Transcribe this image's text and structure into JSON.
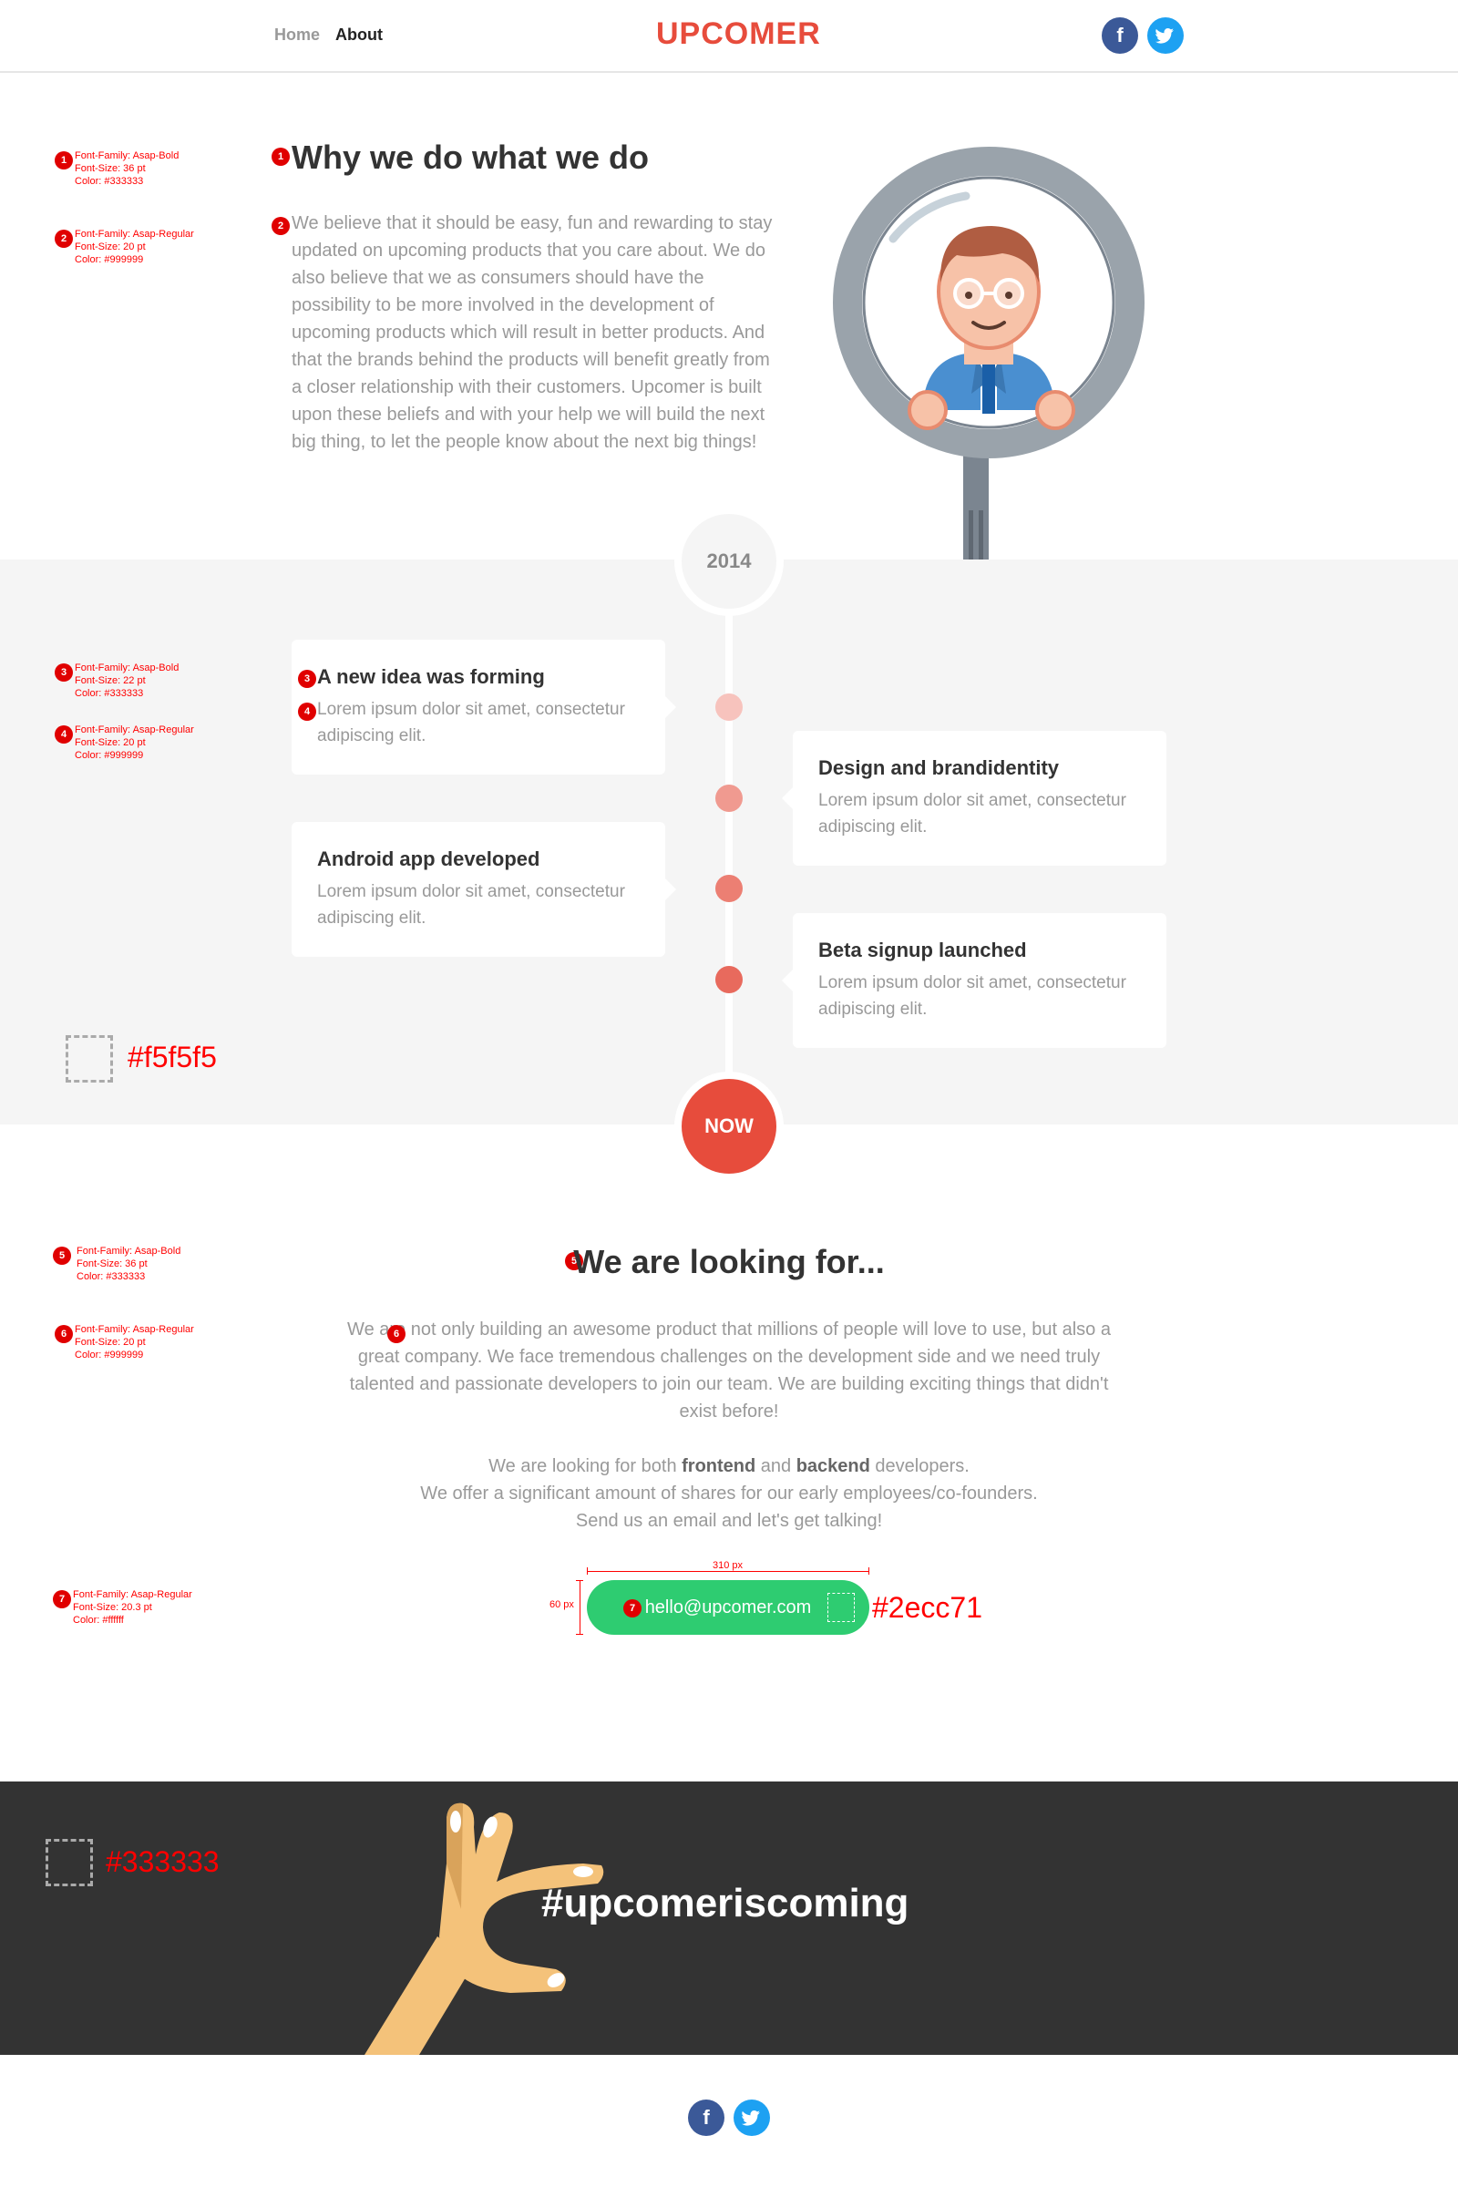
{
  "header": {
    "nav": [
      "Home",
      "About"
    ],
    "logo": "UPCOMER",
    "social": [
      "facebook-icon",
      "twitter-icon"
    ]
  },
  "annotations": {
    "a1": [
      "Font-Family: Asap-Bold",
      "Font-Size: 36 pt",
      "Color: #333333"
    ],
    "a2": [
      "Font-Family: Asap-Regular",
      "Font-Size: 20 pt",
      "Color: #999999"
    ],
    "a3": [
      "Font-Family: Asap-Bold",
      "Font-Size: 22 pt",
      "Color: #333333"
    ],
    "a4": [
      "Font-Family: Asap-Regular",
      "Font-Size: 20 pt",
      "Color: #999999"
    ],
    "a5": [
      "Font-Family: Asap-Bold",
      "Font-Size: 36 pt",
      "Color: #333333"
    ],
    "a6": [
      "Font-Family: Asap-Regular",
      "Font-Size: 20 pt",
      "Color: #999999"
    ],
    "a7": [
      "Font-Family: Asap-Regular",
      "Font-Size: 20.3 pt",
      "Color: #ffffff"
    ],
    "swatches": [
      "#f5f5f5",
      "#2ecc71",
      "#333333"
    ],
    "button_width": "310 px",
    "button_height": "60 px"
  },
  "why": {
    "title": "Why we do what we do",
    "body": "We believe that it should be easy, fun and rewarding to stay updated on upcoming products that you care about. We do also believe that we as consumers should have the possibility to be more involved in the development of upcoming products which will result in better products. And that the brands behind the products will benefit greatly from a closer relationship with their customers. Upcomer is built upon these beliefs and with your help we will build the next big thing, to let the people know about the next big things!"
  },
  "timeline": {
    "start": "2014",
    "end": "NOW",
    "items": [
      {
        "title": "A new idea was forming",
        "text": "Lorem ipsum dolor sit amet, consectetur adipiscing elit.",
        "dot": "#f7c3bd"
      },
      {
        "title": "Design and brandidentity",
        "text": "Lorem ipsum dolor sit amet, consectetur adipiscing elit.",
        "dot": "#f09a90"
      },
      {
        "title": "Android app developed",
        "text": "Lorem ipsum dolor sit amet, consectetur adipiscing elit.",
        "dot": "#ec7f73"
      },
      {
        "title": "Beta signup launched",
        "text": "Lorem ipsum dolor sit amet, consectetur adipiscing elit.",
        "dot": "#e86a5d"
      }
    ]
  },
  "looking": {
    "title": "We are looking for...",
    "p1": "We are not only building an awesome product that millions of people will love to use, but also a great company. We face tremendous challenges on the development side and we need truly talented and passionate developers to join our team. We are building exciting things that didn't exist before!",
    "p2_pre": "We are looking for both ",
    "p2_frontend": "frontend",
    "p2_and": " and ",
    "p2_backend": "backend",
    "p2_post": " developers.",
    "p3": "We offer a significant amount of shares for our early employees/co-founders.",
    "p4": "Send us an email and let's get talking!",
    "email": "hello@upcomer.com"
  },
  "band": {
    "hashtag": "#upcomeriscoming"
  }
}
